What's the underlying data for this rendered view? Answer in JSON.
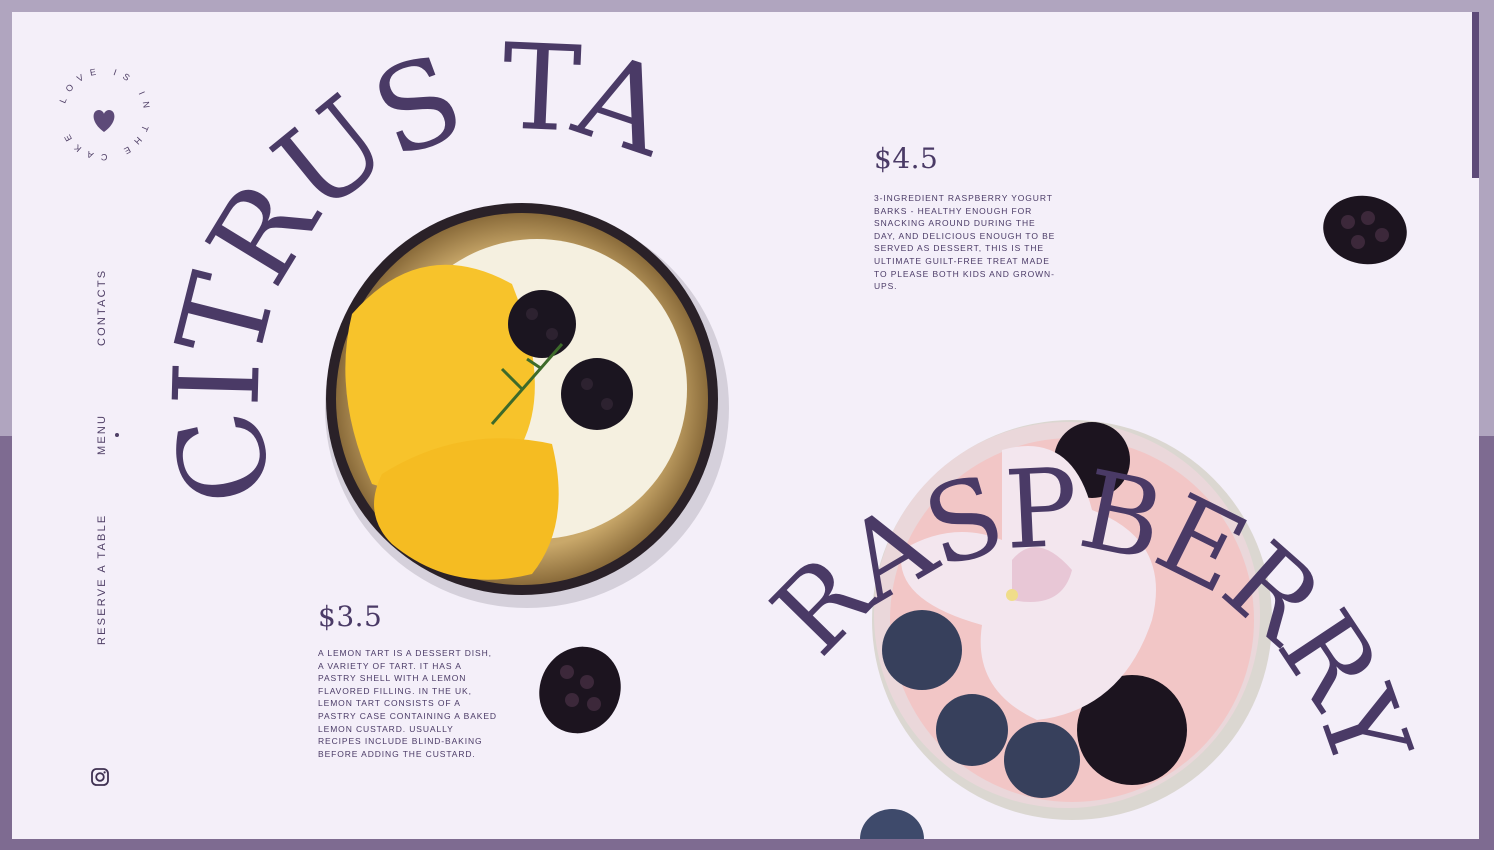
{
  "brand": {
    "badge_text": "LOVE IS IN THE CAKE"
  },
  "nav": {
    "contacts": "CONTACTS",
    "menu": "MENU",
    "reserve": "RESERVE A TABLE"
  },
  "social": {
    "instagram_icon": "instagram-icon"
  },
  "products": [
    {
      "title": "CITRUS TART",
      "price": "$3.5",
      "description": "A lemon tart is a dessert dish, a variety of tart. It has a pastry shell with a lemon flavored filling. In the UK, lemon tart consists of a pastry case containing a baked lemon custard. Usually recipes include blind-baking before adding the custard."
    },
    {
      "title": "RASPBERRY YOGURT",
      "price": "$4.5",
      "description": "3-ingredient raspberry yogurt barks - healthy enough for snacking around during the day, and delicious enough to be served as dessert, this is the ultimate guilt-free treat made to please both kids and grown-ups."
    }
  ],
  "colors": {
    "accent": "#4a3a66",
    "background": "#f4eff9",
    "frame_top": "#b0a5bf",
    "frame_bottom": "#7e6b91"
  }
}
